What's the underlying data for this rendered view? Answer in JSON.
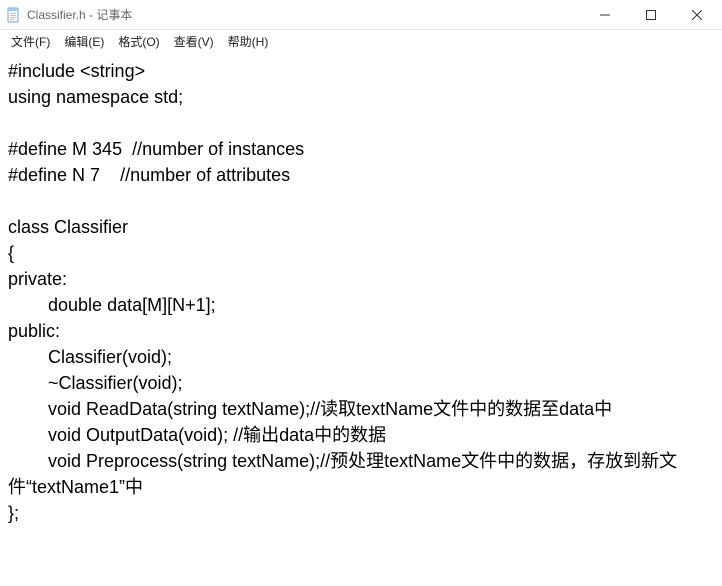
{
  "titlebar": {
    "title": "Classifier.h - 记事本"
  },
  "menubar": {
    "items": [
      "文件(F)",
      "编辑(E)",
      "格式(O)",
      "查看(V)",
      "帮助(H)"
    ]
  },
  "editor": {
    "text": "#include <string>\nusing namespace std;\n\n#define M 345  //number of instances\n#define N 7    //number of attributes\n\nclass Classifier\n{\nprivate:\n\tdouble data[M][N+1];\npublic:\n\tClassifier(void);\n\t~Classifier(void);\n\tvoid ReadData(string textName);//读取textName文件中的数据至data中\n\tvoid OutputData(void); //输出data中的数据\n\tvoid Preprocess(string textName);//预处理textName文件中的数据，存放到新文件“textName1”中\n};"
  }
}
